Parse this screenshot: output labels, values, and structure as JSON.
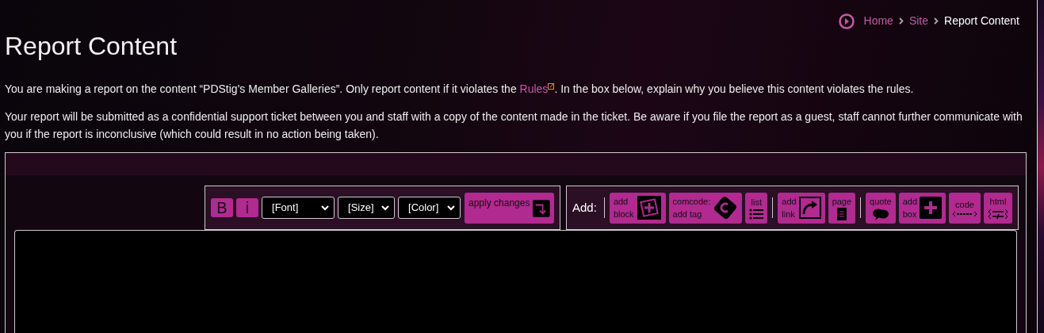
{
  "breadcrumb": [
    {
      "label": "Home",
      "kind": "link"
    },
    {
      "label": "Site",
      "kind": "link"
    },
    {
      "label": "Report Content",
      "kind": "current"
    }
  ],
  "title": "Report Content",
  "intro": {
    "before": "You are making a report on the content “PDStig's Member Galleries”. Only report content if it violates the ",
    "link": "Rules",
    "after": ". In the box below, explain why you believe this content violates the rules."
  },
  "notice": "Your report will be submitted as a confidential support ticket between you and staff with a copy of the content made in the ticket. Be aware if you file the report as a guest, staff cannot further communicate with you if the report is inconclusive (which could result in no action being taken).",
  "format_buttons": [
    {
      "label": "B"
    },
    {
      "label": "i"
    }
  ],
  "selects": [
    {
      "value": "[Font]"
    },
    {
      "value": "[Size]"
    },
    {
      "value": "[Color]"
    }
  ],
  "apply_button": "apply changes",
  "add_label": "Add:",
  "add_groups": [
    [
      {
        "lines": [
          "add",
          "block"
        ],
        "kind": "block"
      },
      {
        "lines": [
          "comcode:",
          "add tag"
        ],
        "kind": "tag"
      },
      {
        "lines": [
          "list"
        ],
        "kind": "list"
      }
    ],
    [
      {
        "lines": [
          "add",
          "link"
        ],
        "kind": "link"
      },
      {
        "lines": [
          "page"
        ],
        "kind": "page"
      }
    ],
    [
      {
        "lines": [
          "quote"
        ],
        "kind": "quote"
      },
      {
        "lines": [
          "add",
          "box"
        ],
        "kind": "box"
      },
      {
        "lines": [
          "code"
        ],
        "kind": "code"
      },
      {
        "lines": [
          "html"
        ],
        "kind": "html"
      }
    ]
  ]
}
